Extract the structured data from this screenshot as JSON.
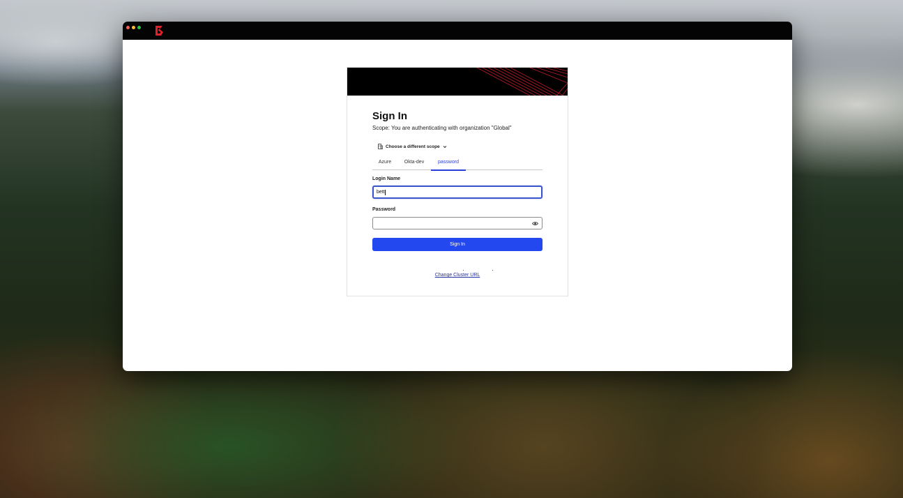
{
  "window": {
    "traffic_lights": [
      "close",
      "minimize",
      "zoom"
    ],
    "app_icon": "boundary-logo-icon"
  },
  "login": {
    "title": "Sign In",
    "scope_text": "Scope: You are authenticating with organization \"Global\"",
    "scope_chooser_label": "Choose a different scope",
    "tabs": [
      {
        "label": "Azure",
        "active": false
      },
      {
        "label": "Okta-dev",
        "active": false
      },
      {
        "label": "password",
        "active": true
      }
    ],
    "login_name_label": "Login Name",
    "login_name_value": "bett",
    "password_label": "Password",
    "password_value": "",
    "sign_in_button": "Sign In",
    "change_cluster_link": "Change Cluster URL"
  },
  "colors": {
    "accent": "#2448f0",
    "tab_active": "#2a3fd6",
    "link": "#2430a8",
    "logo": "#e0222b"
  }
}
